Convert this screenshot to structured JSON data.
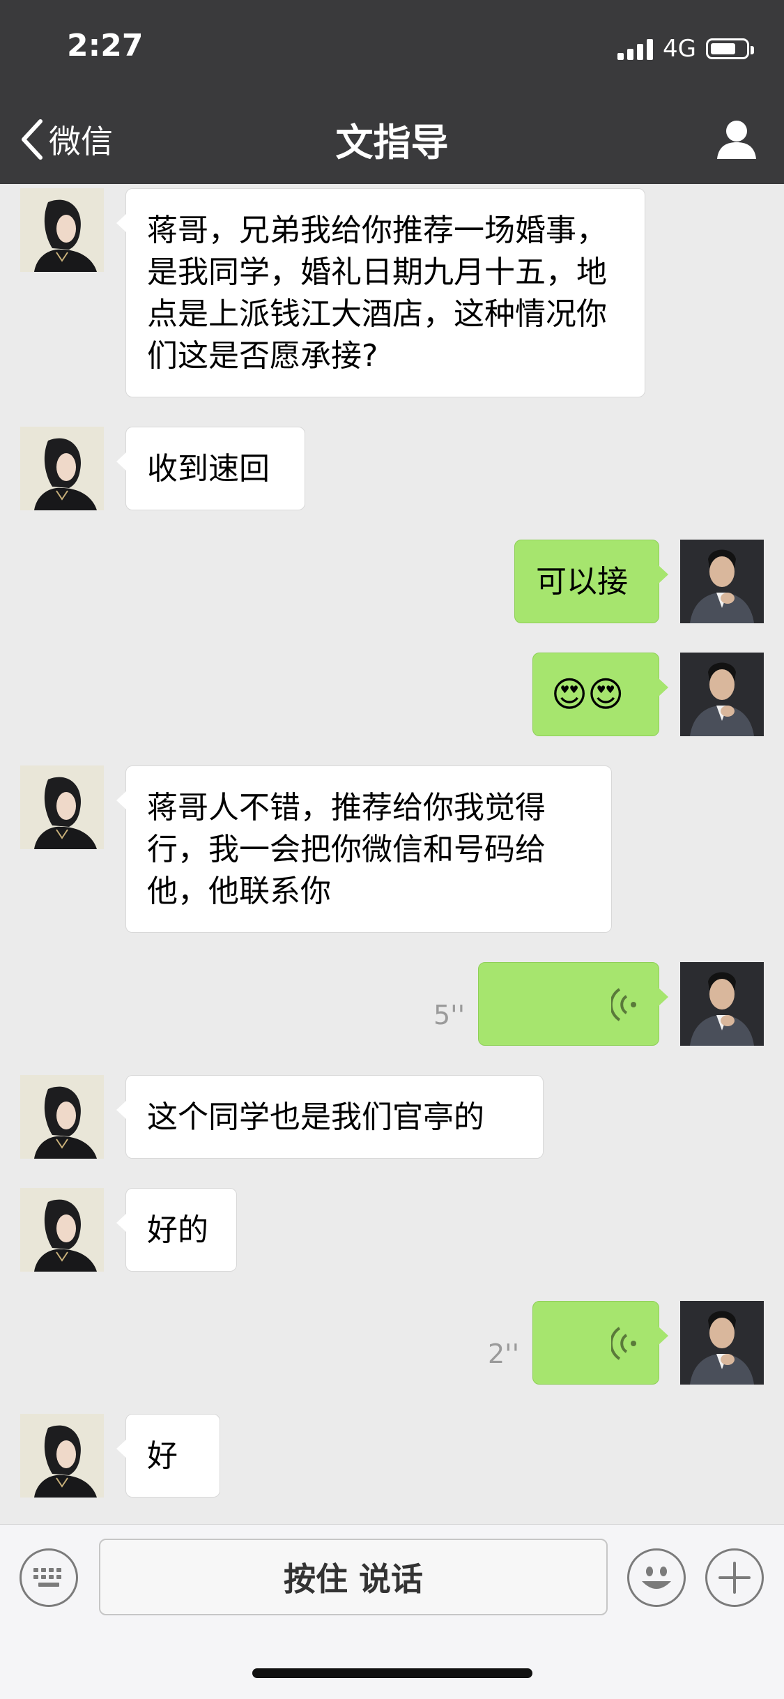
{
  "status": {
    "time": "2:27",
    "network": "4G",
    "battery_level": 0.7
  },
  "nav": {
    "back_label": "微信",
    "title": "文指导"
  },
  "messages": [
    {
      "from": "contact",
      "text": "蒋哥，兄弟我给你推荐一场婚事，是我同学，婚礼日期九月十五，地点是上派钱江大酒店，这种情况你们这是否愿承接?"
    },
    {
      "from": "contact",
      "text": "收到速回"
    },
    {
      "from": "me",
      "text": "可以接"
    },
    {
      "from": "me",
      "emoji": "😍😍"
    },
    {
      "from": "contact",
      "text": "蒋哥人不错，推荐给你我觉得行，我一会把你微信和号码给他，他联系你"
    },
    {
      "from": "me",
      "voice_duration": "5''"
    },
    {
      "from": "contact",
      "text": "这个同学也是我们官亭的"
    },
    {
      "from": "contact",
      "text": "好的"
    },
    {
      "from": "me",
      "voice_duration": "2''"
    },
    {
      "from": "contact",
      "text": "好"
    }
  ],
  "input_bar": {
    "hold_to_talk_label": "按住 说话"
  },
  "colors": {
    "header_bg": "#3a3a3c",
    "chat_bg": "#ebebeb",
    "my_bubble": "#a6e56e",
    "their_bubble": "#ffffff"
  }
}
